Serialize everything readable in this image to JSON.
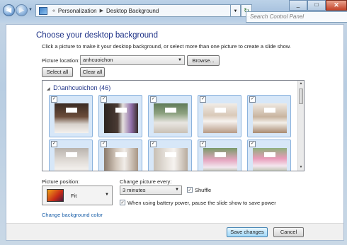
{
  "titlebar": {
    "breadcrumb": [
      "Personalization",
      "Desktop Background"
    ],
    "search_placeholder": "Search Control Panel",
    "buttons": {
      "back": "back-arrow",
      "forward": "forward-arrow",
      "refresh": "refresh",
      "minimize": "minimize",
      "maximize": "maximize",
      "close": "close"
    }
  },
  "main": {
    "heading": "Choose your desktop background",
    "description": "Click a picture to make it your desktop background, or select more than one picture to create a slide show.",
    "picture_location_label": "Picture location:",
    "picture_location_value": "anhcuoichon",
    "browse_label": "Browse...",
    "select_all_label": "Select all",
    "clear_all_label": "Clear all"
  },
  "gallery": {
    "group_title": "D:\\anhcuoichon (46)",
    "check_glyph": "✓",
    "items": [
      {
        "checked": true,
        "scene": "wedding-couple-dark"
      },
      {
        "checked": true,
        "scene": "bride-bouquet"
      },
      {
        "checked": true,
        "scene": "couple-outdoor"
      },
      {
        "checked": true,
        "scene": "reception-table"
      },
      {
        "checked": true,
        "scene": "reception-hall"
      },
      {
        "checked": true,
        "scene": "bride-portrait"
      },
      {
        "checked": true,
        "scene": "couple-doorway"
      },
      {
        "checked": true,
        "scene": "couple-archway"
      },
      {
        "checked": true,
        "scene": "flower-arch"
      },
      {
        "checked": true,
        "scene": "garden-flowers"
      }
    ]
  },
  "options": {
    "picture_position_label": "Picture position:",
    "picture_position_value": "Fit",
    "change_every_label": "Change picture every:",
    "interval_value": "3 minutes",
    "shuffle_label": "Shuffle",
    "shuffle_checked": true,
    "battery_label": "When using battery power, pause the slide show to save power",
    "battery_checked": true,
    "bg_color_link": "Change background color"
  },
  "footer": {
    "save_label": "Save changes",
    "cancel_label": "Cancel"
  },
  "colors": {
    "heading": "#1e3287",
    "link": "#1a5fa8",
    "selection": "#d7e7f8"
  }
}
